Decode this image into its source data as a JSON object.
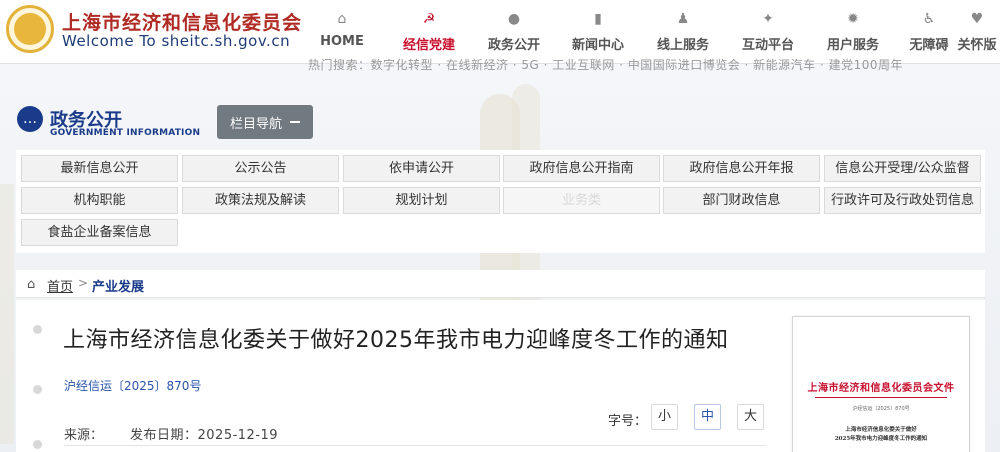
{
  "header": {
    "title": "上海市经济和信息化委员会",
    "subtitle": "Welcome To sheitc.sh.gov.cn",
    "nav": [
      {
        "label": "HOME",
        "icon": "home-icon",
        "glyph": "⌂",
        "active": false
      },
      {
        "label": "经信党建",
        "icon": "party-emblem-icon",
        "glyph": "☭",
        "active": true
      },
      {
        "label": "政务公开",
        "icon": "chat-bubble-icon",
        "glyph": "●",
        "active": false
      },
      {
        "label": "新闻中心",
        "icon": "news-bars-icon",
        "glyph": "▮",
        "active": false
      },
      {
        "label": "线上服务",
        "icon": "user-service-icon",
        "glyph": "♟",
        "active": false
      },
      {
        "label": "互动平台",
        "icon": "interact-icon",
        "glyph": "✦",
        "active": false
      },
      {
        "label": "用户服务",
        "icon": "gear-icon",
        "glyph": "✹",
        "active": false
      },
      {
        "label": "无障碍",
        "icon": "accessibility-icon",
        "glyph": "♿",
        "active": false
      },
      {
        "label": "关怀版",
        "icon": "heart-care-icon",
        "glyph": "♥",
        "active": false
      }
    ]
  },
  "hot_search": "热门搜索：数字化转型 · 在线新经济 · 5G · 工业互联网 · 中国国际进口博览会 · 新能源汽车 · 建党100周年",
  "section": {
    "title": "政务公开",
    "en": "GOVERNMENT INFORMATION",
    "nav_button": "栏目导航"
  },
  "categories": [
    "最新信息公开",
    "公示公告",
    "依申请公开",
    "政府信息公开指南",
    "政府信息公开年报",
    "信息公开受理/公众监督",
    "机构职能",
    "政策法规及解读",
    "规划计划",
    "业务类",
    "部门财政信息",
    "行政许可及行政处罚信息",
    "食盐企业备案信息"
  ],
  "breadcrumb": {
    "home": "首页",
    "separator": ">",
    "current": "产业发展"
  },
  "article": {
    "title": "上海市经济信息化委关于做好2025年我市电力迎峰度冬工作的通知",
    "doc_number": "沪经信运〔2025〕870号",
    "source_label": "来源：",
    "date": "发布日期：2025-12-19",
    "font_size_label": "字号：",
    "font_sizes": [
      "小",
      "中",
      "大"
    ],
    "font_size_selected": "中"
  },
  "doc_thumbnail": {
    "header": "上海市经济和信息化委员会文件",
    "number": "沪经信运〔2025〕870号",
    "line1": "上海市经济信息化委关于做好",
    "line2": "2025年我市电力迎峰度冬工作的通知"
  },
  "colors": {
    "brand_red": "#c8102e",
    "brand_blue": "#1a3b8a",
    "link_blue": "#2a55a8",
    "nav_button_gray": "#717981"
  }
}
